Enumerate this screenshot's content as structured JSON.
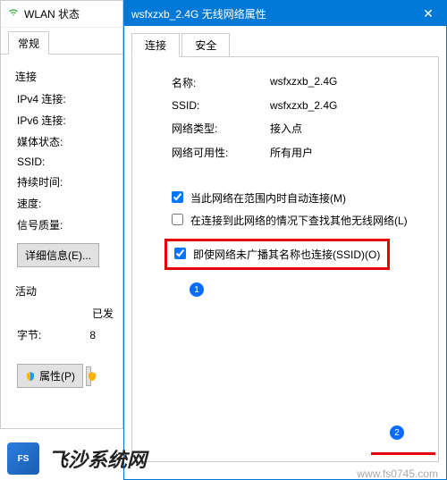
{
  "back": {
    "title": "WLAN 状态",
    "tab": "常规",
    "sectionConnect": "连接",
    "rows": {
      "ipv4": "IPv4 连接:",
      "ipv6": "IPv6 连接:",
      "media": "媒体状态:",
      "ssid": "SSID:",
      "duration": "持续时间:",
      "speed": "速度:",
      "signal": "信号质量:"
    },
    "detailsBtn": "详细信息(E)...",
    "sectionActivity": "活动",
    "activityHeader": "已发",
    "bytes": "字节:",
    "bytesVal": "8",
    "propsBtn": "属性(P)"
  },
  "front": {
    "title": "wsfxzxb_2.4G 无线网络属性",
    "tabs": {
      "connect": "连接",
      "security": "安全"
    },
    "info": {
      "nameLabel": "名称:",
      "name": "wsfxzxb_2.4G",
      "ssidLabel": "SSID:",
      "ssid": "wsfxzxb_2.4G",
      "typeLabel": "网络类型:",
      "type": "接入点",
      "availLabel": "网络可用性:",
      "avail": "所有用户"
    },
    "checks": {
      "auto": "当此网络在范围内时自动连接(M)",
      "lookup": "在连接到此网络的情况下查找其他无线网络(L)",
      "hidden": "即使网络未广播其名称也连接(SSID)(O)"
    },
    "callout1": "1",
    "callout2": "2"
  },
  "banner": {
    "logoText": "FS",
    "siteName": "飞沙系统网",
    "watermark": "www.fs0745.com"
  }
}
